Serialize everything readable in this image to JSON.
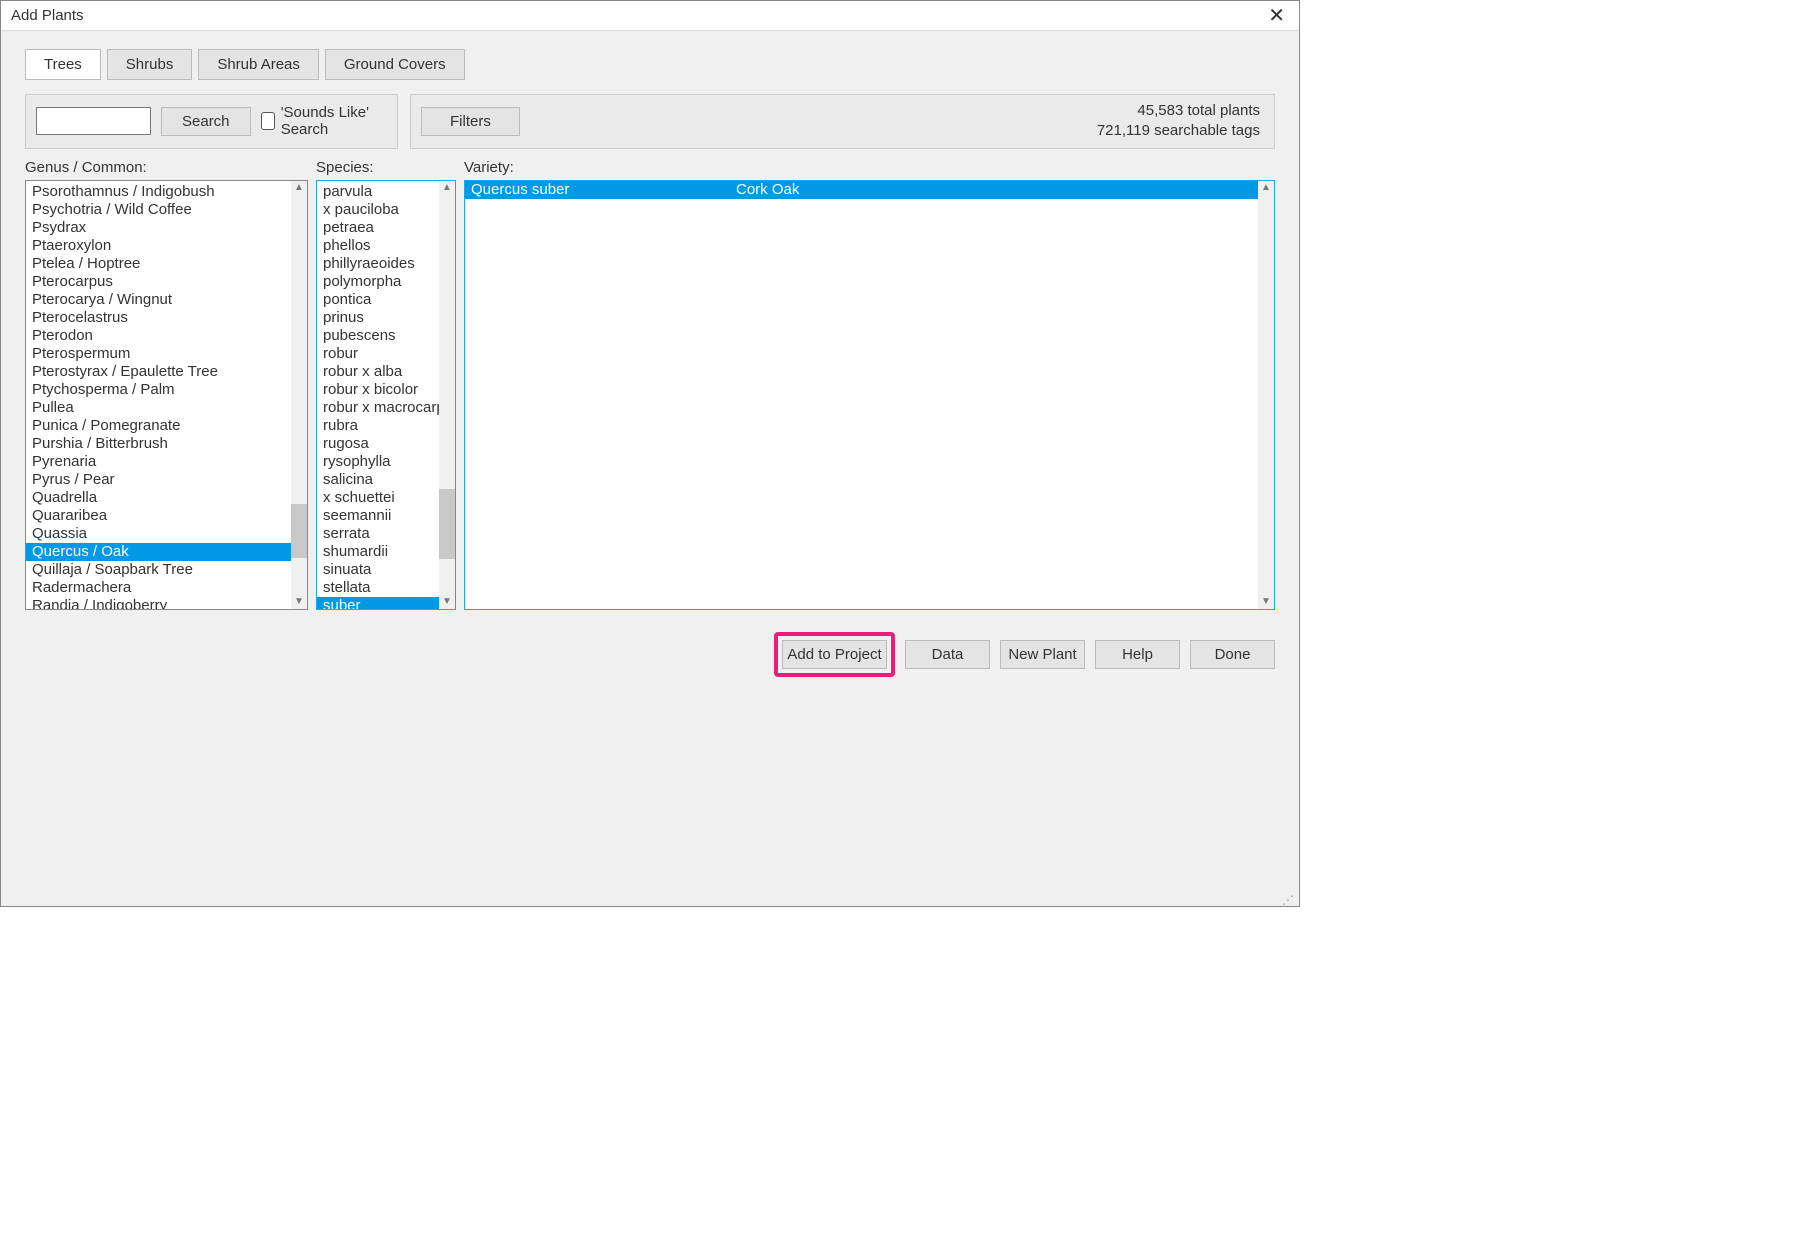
{
  "window": {
    "title": "Add Plants"
  },
  "tabs": [
    {
      "label": "Trees",
      "active": true
    },
    {
      "label": "Shrubs",
      "active": false
    },
    {
      "label": "Shrub Areas",
      "active": false
    },
    {
      "label": "Ground Covers",
      "active": false
    }
  ],
  "toolbar": {
    "search_value": "",
    "search_button": "Search",
    "sounds_like_label": "'Sounds Like' Search",
    "sounds_like_checked": false,
    "filters_button": "Filters",
    "stats_line1": "45,583 total plants",
    "stats_line2": "721,119 searchable tags"
  },
  "columns": {
    "genus_label": "Genus / Common:",
    "species_label": "Species:",
    "variety_label": "Variety:"
  },
  "genus": {
    "selected_index": 20,
    "items": [
      "Psorothamnus / Indigobush",
      "Psychotria / Wild Coffee",
      "Psydrax",
      "Ptaeroxylon",
      "Ptelea / Hoptree",
      "Pterocarpus",
      "Pterocarya / Wingnut",
      "Pterocelastrus",
      "Pterodon",
      "Pterospermum",
      "Pterostyrax / Epaulette Tree",
      "Ptychosperma / Palm",
      "Pullea",
      "Punica / Pomegranate",
      "Purshia / Bitterbrush",
      "Pyrenaria",
      "Pyrus / Pear",
      "Quadrella",
      "Quararibea",
      "Quassia",
      "Quercus / Oak",
      "Quillaja / Soapbark Tree",
      "Radermachera",
      "Randia / Indigoberry"
    ]
  },
  "species": {
    "selected_index": 23,
    "items": [
      "parvula",
      "x pauciloba",
      "petraea",
      "phellos",
      "phillyraeoides",
      "polymorpha",
      "pontica",
      "prinus",
      "pubescens",
      "robur",
      "robur x alba",
      "robur x bicolor",
      "robur x macrocarpa",
      "rubra",
      "rugosa",
      "rysophylla",
      "salicina",
      "x schuettei",
      "seemannii",
      "serrata",
      "shumardii",
      "sinuata",
      "stellata",
      "suber"
    ]
  },
  "variety": {
    "selected_index": 0,
    "items": [
      {
        "name": "Quercus suber",
        "common": "Cork Oak"
      }
    ]
  },
  "footer": {
    "add_to_project": "Add to Project",
    "data": "Data",
    "new_plant": "New Plant",
    "help": "Help",
    "done": "Done"
  }
}
